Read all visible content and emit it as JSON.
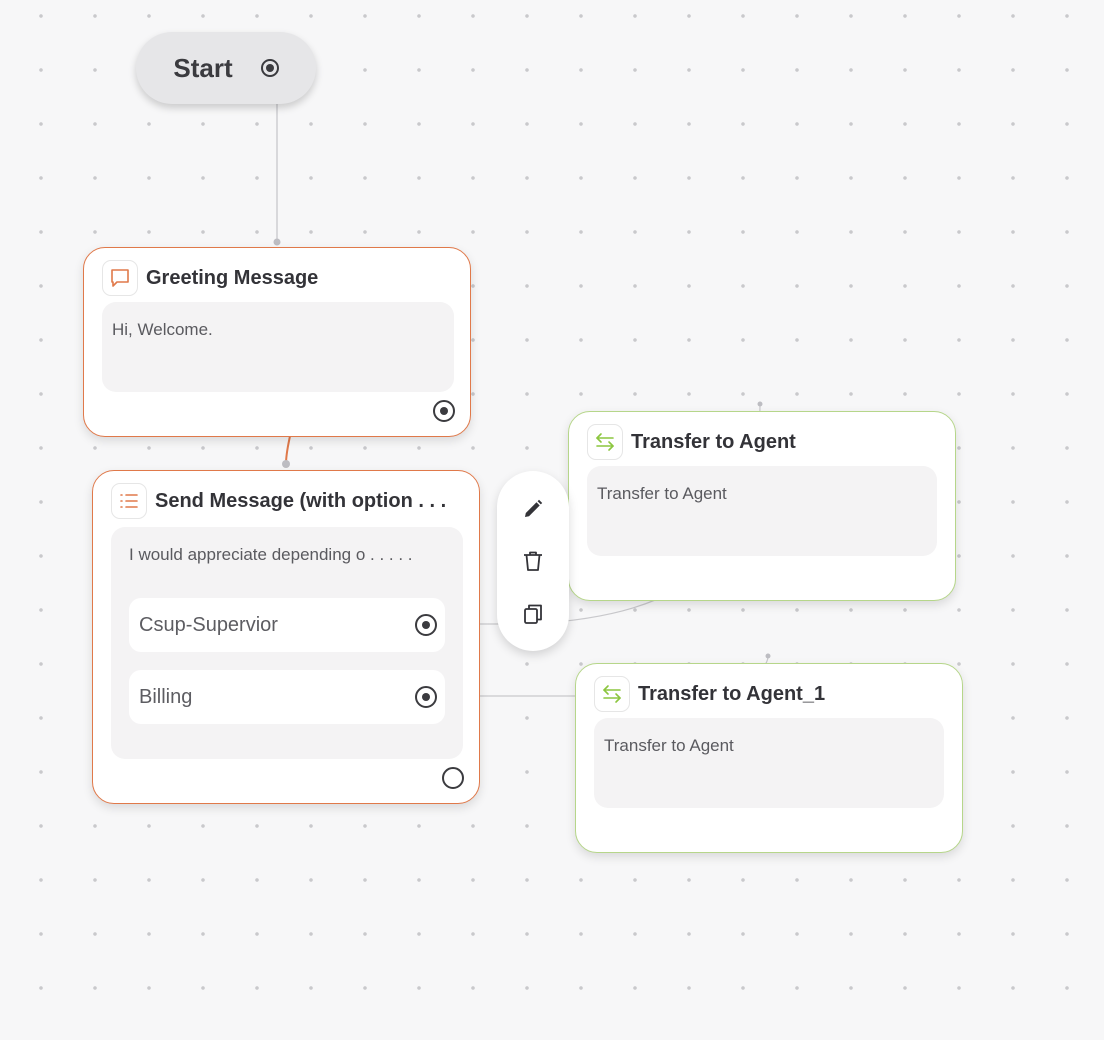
{
  "start": {
    "label": "Start"
  },
  "nodes": {
    "greeting": {
      "title": "Greeting Message",
      "message": "Hi, Welcome."
    },
    "send_message": {
      "title": "Send Message (with option . . .",
      "message": "I would appreciate depending o . . . . .",
      "options": [
        "Csup-Supervior",
        "Billing"
      ]
    },
    "transfer_1": {
      "title": "Transfer to Agent",
      "message": "Transfer to Agent"
    },
    "transfer_2": {
      "title": "Transfer to Agent_1",
      "message": "Transfer to Agent"
    }
  },
  "toolbar": {
    "actions": [
      "edit-icon",
      "delete-icon",
      "copy-icon"
    ]
  },
  "colors": {
    "orange_accent": "#e0794a",
    "green_accent": "#b6d68a",
    "canvas": "#f7f7f8"
  }
}
